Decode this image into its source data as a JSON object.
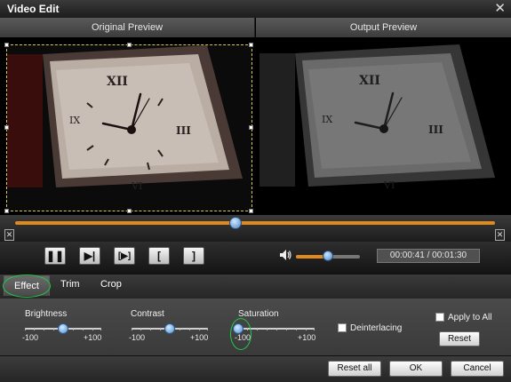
{
  "window": {
    "title": "Video Edit",
    "close_glyph": "✕"
  },
  "preview": {
    "original_label": "Original Preview",
    "output_label": "Output Preview"
  },
  "timeline": {
    "progress": 0.46,
    "start_marker": "✕",
    "end_marker": "✕"
  },
  "playback": {
    "buttons": [
      {
        "name": "pause-button",
        "glyph": "❚❚"
      },
      {
        "name": "play-next-frame-button",
        "glyph": "▶|"
      },
      {
        "name": "step-frame-button",
        "glyph": "[▶]"
      },
      {
        "name": "set-start-button",
        "glyph": "["
      },
      {
        "name": "set-end-button",
        "glyph": "]"
      }
    ],
    "volume": 0.5,
    "time_display": "00:00:41 / 00:01:30"
  },
  "tabs": {
    "effect": "Effect",
    "trim": "Trim",
    "crop": "Crop"
  },
  "effect": {
    "brightness": {
      "label": "Brightness",
      "min": "-100",
      "max": "+100",
      "value": 0
    },
    "contrast": {
      "label": "Contrast",
      "min": "-100",
      "max": "+100",
      "value": 0
    },
    "saturation": {
      "label": "Saturation",
      "min": "-100",
      "max": "+100",
      "value": -100
    },
    "deinterlacing_label": "Deinterlacing",
    "apply_to_all_label": "Apply to All",
    "reset_label": "Reset"
  },
  "footer": {
    "reset_all": "Reset all",
    "ok": "OK",
    "cancel": "Cancel"
  },
  "colors": {
    "accent": "#e08a1e",
    "highlight_ring": "#22c94a",
    "knob": "#4e8ed2"
  }
}
